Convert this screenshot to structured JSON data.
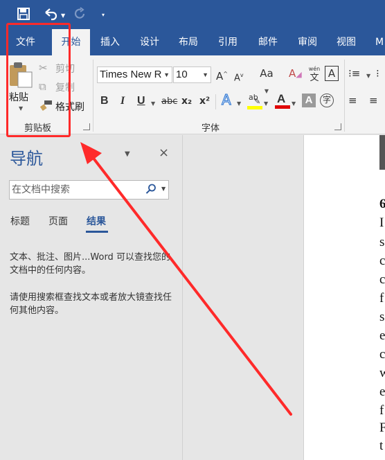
{
  "quick_access": {
    "save_icon": "save-icon",
    "undo_icon": "undo-icon",
    "redo_icon": "redo-icon",
    "customize_icon": "customize-qat-icon"
  },
  "tabs": [
    {
      "label": "文件"
    },
    {
      "label": "开始"
    },
    {
      "label": "插入"
    },
    {
      "label": "设计"
    },
    {
      "label": "布局"
    },
    {
      "label": "引用"
    },
    {
      "label": "邮件"
    },
    {
      "label": "审阅"
    },
    {
      "label": "视图"
    },
    {
      "label": "M"
    }
  ],
  "ribbon": {
    "clipboard": {
      "paste": "粘贴",
      "cut": "剪切",
      "copy": "复制",
      "format_painter": "格式刷",
      "group_label": "剪贴板"
    },
    "font": {
      "font_name": "Times New R",
      "font_size": "10",
      "change_case": "Aa",
      "bold": "B",
      "italic": "I",
      "underline": "U",
      "strikethrough": "abc",
      "subscript": "x₂",
      "superscript": "x²",
      "phonetic": "wén",
      "phonetic_char": "文",
      "char_border": "A",
      "group_label": "字体"
    }
  },
  "nav_pane": {
    "title": "导航",
    "close": "×",
    "search_placeholder": "在文档中搜索",
    "tabs": [
      "标题",
      "页面",
      "结果"
    ],
    "message1": "文本、批注、图片...Word 可以查找您的文档中的任何内容。",
    "message2": "请使用搜索框查找文本或者放大镜查找任何其他内容。"
  },
  "document": {
    "visible_chars": [
      "6",
      "I",
      "s",
      "c",
      "c",
      "f",
      "s",
      "e",
      "c",
      "w",
      "e",
      "f",
      "F",
      "t"
    ]
  },
  "colors": {
    "word_blue": "#2b579a",
    "annotation_red": "#ff2a2a",
    "highlight_yellow": "#ffff00",
    "font_color_red": "#e00000"
  }
}
